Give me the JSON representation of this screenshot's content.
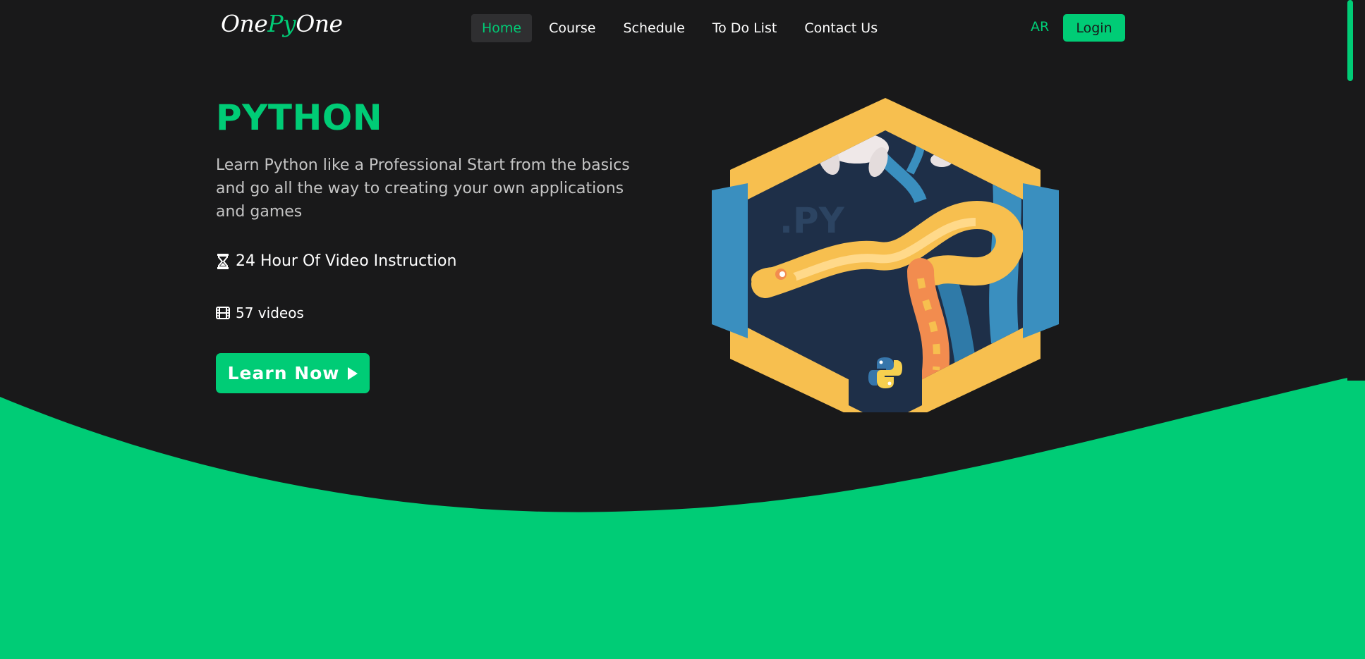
{
  "brand": {
    "part1": "One",
    "part2": "Py",
    "part3": "One"
  },
  "nav": {
    "items": [
      {
        "label": "Home",
        "active": true
      },
      {
        "label": "Course",
        "active": false
      },
      {
        "label": "Schedule",
        "active": false
      },
      {
        "label": "To Do List",
        "active": false
      },
      {
        "label": "Contact Us",
        "active": false
      }
    ],
    "lang_label": "AR",
    "login_label": "Login"
  },
  "hero": {
    "title": "PYTHON",
    "description": "Learn Python like a Professional Start from the basics and go all the way to creating your own applications and games",
    "hours_text": "24 Hour Of Video Instruction",
    "hours_icon": "hourglass-icon",
    "videos_text": "57 videos",
    "videos_icon": "film-icon",
    "cta_label": "Learn Now",
    "cta_icon": "play-icon"
  },
  "badge": {
    "text": ".PY",
    "logo": "python-logo"
  },
  "colors": {
    "background": "#19191a",
    "accent": "#00cc76",
    "text": "#ffffff",
    "muted_text": "#c4c4c4",
    "badge_gold": "#f7bf4f",
    "badge_blue": "#3a8fbf",
    "badge_navy": "#1e2f48"
  }
}
